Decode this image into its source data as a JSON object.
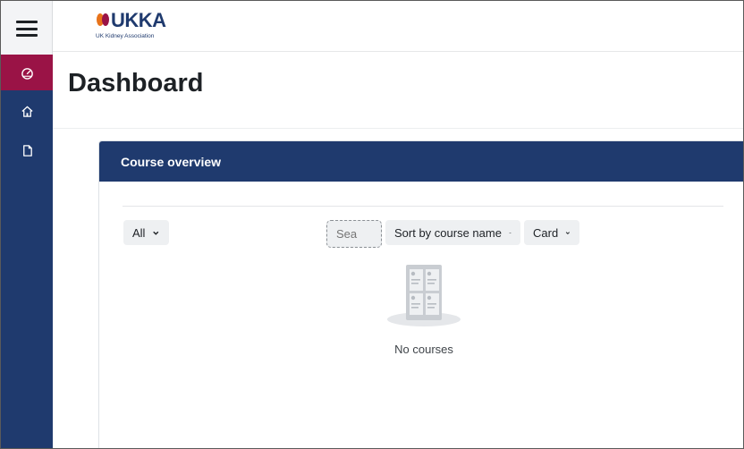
{
  "brand": {
    "name": "UKKA",
    "subtitle": "UK Kidney Association",
    "primary_color": "#1f3a6e",
    "accent_color": "#9a1346"
  },
  "sidebar": {
    "menu_icon": "hamburger-icon",
    "items": [
      {
        "icon": "dashboard-icon",
        "active": true
      },
      {
        "icon": "home-icon",
        "active": false
      },
      {
        "icon": "file-icon",
        "active": false
      }
    ]
  },
  "page": {
    "title": "Dashboard"
  },
  "course_overview": {
    "header": "Course overview",
    "filter_label": "All",
    "search_placeholder": "Sea",
    "sort_label": "Sort by course name",
    "view_label": "Card",
    "empty_text": "No courses"
  }
}
